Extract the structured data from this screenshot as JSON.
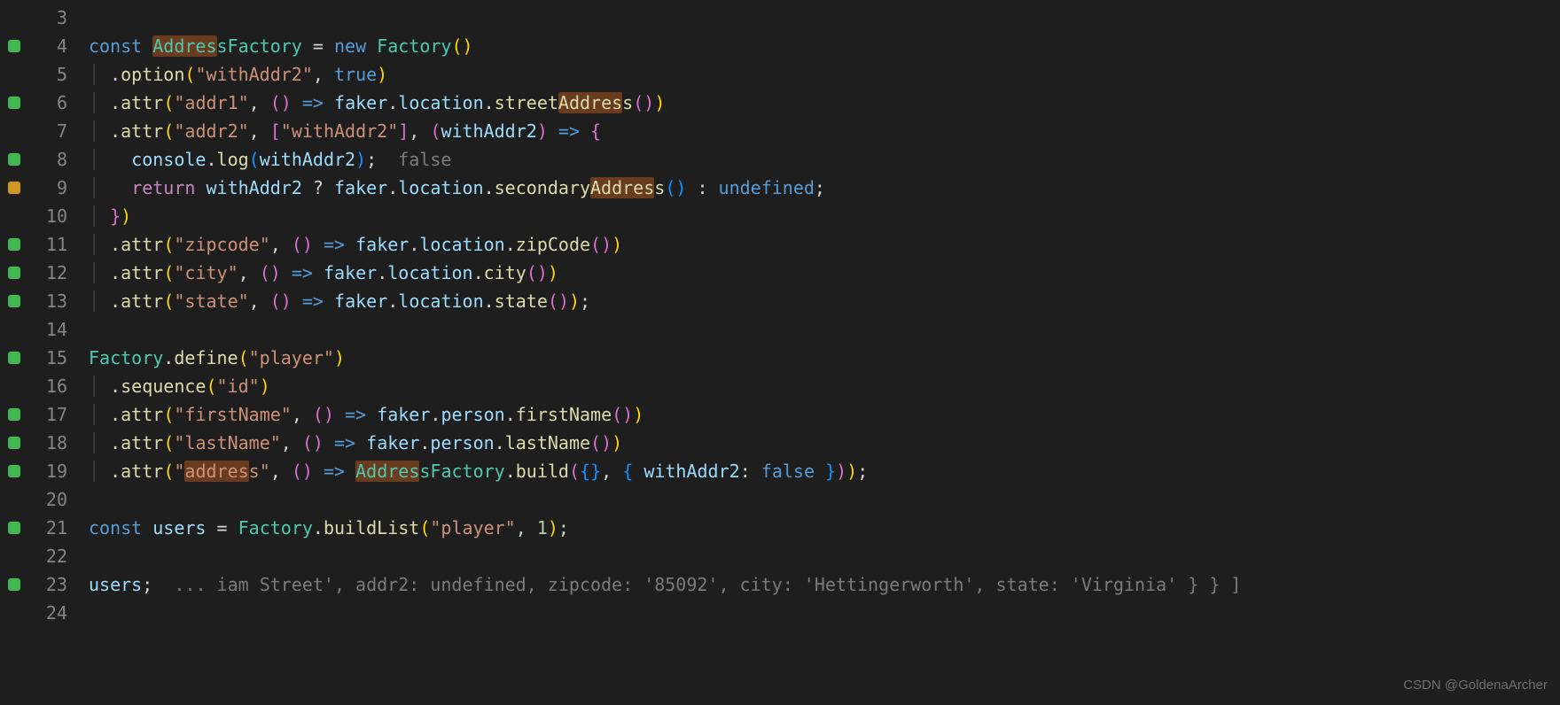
{
  "watermark": "CSDN @GoldenaArcher",
  "lines": [
    {
      "n": "3",
      "mark": null,
      "tokens": [
        {
          "t": "",
          "c": ""
        }
      ]
    },
    {
      "n": "4",
      "mark": "green",
      "tokens": [
        {
          "t": "const ",
          "c": "kw"
        },
        {
          "t": "Addres",
          "c": "cls hl"
        },
        {
          "t": "s",
          "c": "cls"
        },
        {
          "t": "Factory",
          "c": "cls"
        },
        {
          "t": " ",
          "c": ""
        },
        {
          "t": "=",
          "c": "punct"
        },
        {
          "t": " ",
          "c": ""
        },
        {
          "t": "new ",
          "c": "kw"
        },
        {
          "t": "Factory",
          "c": "cls"
        },
        {
          "t": "(",
          "c": "punct-yellow"
        },
        {
          "t": ")",
          "c": "punct-yellow"
        }
      ]
    },
    {
      "n": "5",
      "mark": null,
      "indent": "  ",
      "guide": true,
      "tokens": [
        {
          "t": ".",
          "c": "punct"
        },
        {
          "t": "option",
          "c": "fn"
        },
        {
          "t": "(",
          "c": "punct-yellow"
        },
        {
          "t": "\"withAddr2\"",
          "c": "str"
        },
        {
          "t": ", ",
          "c": "punct"
        },
        {
          "t": "true",
          "c": "bool"
        },
        {
          "t": ")",
          "c": "punct-yellow"
        }
      ]
    },
    {
      "n": "6",
      "mark": "green",
      "indent": "  ",
      "guide": true,
      "tokens": [
        {
          "t": ".",
          "c": "punct"
        },
        {
          "t": "attr",
          "c": "fn"
        },
        {
          "t": "(",
          "c": "punct-yellow"
        },
        {
          "t": "\"addr1\"",
          "c": "str"
        },
        {
          "t": ", ",
          "c": "punct"
        },
        {
          "t": "(",
          "c": "punct-pink"
        },
        {
          "t": ")",
          "c": "punct-pink"
        },
        {
          "t": " ",
          "c": ""
        },
        {
          "t": "=>",
          "c": "kw"
        },
        {
          "t": " ",
          "c": ""
        },
        {
          "t": "faker",
          "c": "var"
        },
        {
          "t": ".",
          "c": "punct"
        },
        {
          "t": "location",
          "c": "prop"
        },
        {
          "t": ".",
          "c": "punct"
        },
        {
          "t": "street",
          "c": "fn"
        },
        {
          "t": "Addres",
          "c": "fn hl"
        },
        {
          "t": "s",
          "c": "fn"
        },
        {
          "t": "(",
          "c": "punct-pink"
        },
        {
          "t": ")",
          "c": "punct-pink"
        },
        {
          "t": ")",
          "c": "punct-yellow"
        }
      ]
    },
    {
      "n": "7",
      "mark": null,
      "indent": "  ",
      "guide": true,
      "tokens": [
        {
          "t": ".",
          "c": "punct"
        },
        {
          "t": "attr",
          "c": "fn"
        },
        {
          "t": "(",
          "c": "punct-yellow"
        },
        {
          "t": "\"addr2\"",
          "c": "str"
        },
        {
          "t": ", ",
          "c": "punct"
        },
        {
          "t": "[",
          "c": "punct-pink"
        },
        {
          "t": "\"withAddr2\"",
          "c": "str"
        },
        {
          "t": "]",
          "c": "punct-pink"
        },
        {
          "t": ", ",
          "c": "punct"
        },
        {
          "t": "(",
          "c": "punct-pink"
        },
        {
          "t": "withAddr2",
          "c": "var"
        },
        {
          "t": ")",
          "c": "punct-pink"
        },
        {
          "t": " ",
          "c": ""
        },
        {
          "t": "=>",
          "c": "kw"
        },
        {
          "t": " ",
          "c": ""
        },
        {
          "t": "{",
          "c": "punct-pink"
        }
      ]
    },
    {
      "n": "8",
      "mark": "green",
      "indent": "    ",
      "guide": true,
      "tokens": [
        {
          "t": "console",
          "c": "var"
        },
        {
          "t": ".",
          "c": "punct"
        },
        {
          "t": "log",
          "c": "fn"
        },
        {
          "t": "(",
          "c": "punct-blue"
        },
        {
          "t": "withAddr2",
          "c": "var"
        },
        {
          "t": ")",
          "c": "punct-blue"
        },
        {
          "t": ";",
          "c": "punct"
        },
        {
          "t": "  ",
          "c": ""
        },
        {
          "t": "false",
          "c": "hint"
        }
      ]
    },
    {
      "n": "9",
      "mark": "yellow",
      "indent": "    ",
      "guide": true,
      "tokens": [
        {
          "t": "return ",
          "c": "kw2"
        },
        {
          "t": "withAddr2",
          "c": "var"
        },
        {
          "t": " ",
          "c": ""
        },
        {
          "t": "?",
          "c": "punct"
        },
        {
          "t": " ",
          "c": ""
        },
        {
          "t": "faker",
          "c": "var"
        },
        {
          "t": ".",
          "c": "punct"
        },
        {
          "t": "location",
          "c": "prop"
        },
        {
          "t": ".",
          "c": "punct"
        },
        {
          "t": "secondary",
          "c": "fn"
        },
        {
          "t": "Addres",
          "c": "fn hl"
        },
        {
          "t": "s",
          "c": "fn"
        },
        {
          "t": "(",
          "c": "punct-blue"
        },
        {
          "t": ")",
          "c": "punct-blue"
        },
        {
          "t": " ",
          "c": ""
        },
        {
          "t": ":",
          "c": "punct"
        },
        {
          "t": " ",
          "c": ""
        },
        {
          "t": "undefined",
          "c": "bool"
        },
        {
          "t": ";",
          "c": "punct"
        }
      ]
    },
    {
      "n": "10",
      "mark": null,
      "indent": "  ",
      "guide": true,
      "tokens": [
        {
          "t": "}",
          "c": "punct-pink"
        },
        {
          "t": ")",
          "c": "punct-yellow"
        }
      ]
    },
    {
      "n": "11",
      "mark": "green",
      "indent": "  ",
      "guide": true,
      "tokens": [
        {
          "t": ".",
          "c": "punct"
        },
        {
          "t": "attr",
          "c": "fn"
        },
        {
          "t": "(",
          "c": "punct-yellow"
        },
        {
          "t": "\"zipcode\"",
          "c": "str"
        },
        {
          "t": ", ",
          "c": "punct"
        },
        {
          "t": "(",
          "c": "punct-pink"
        },
        {
          "t": ")",
          "c": "punct-pink"
        },
        {
          "t": " ",
          "c": ""
        },
        {
          "t": "=>",
          "c": "kw"
        },
        {
          "t": " ",
          "c": ""
        },
        {
          "t": "faker",
          "c": "var"
        },
        {
          "t": ".",
          "c": "punct"
        },
        {
          "t": "location",
          "c": "prop"
        },
        {
          "t": ".",
          "c": "punct"
        },
        {
          "t": "zipCode",
          "c": "fn"
        },
        {
          "t": "(",
          "c": "punct-pink"
        },
        {
          "t": ")",
          "c": "punct-pink"
        },
        {
          "t": ")",
          "c": "punct-yellow"
        }
      ]
    },
    {
      "n": "12",
      "mark": "green",
      "indent": "  ",
      "guide": true,
      "tokens": [
        {
          "t": ".",
          "c": "punct"
        },
        {
          "t": "attr",
          "c": "fn"
        },
        {
          "t": "(",
          "c": "punct-yellow"
        },
        {
          "t": "\"city\"",
          "c": "str"
        },
        {
          "t": ", ",
          "c": "punct"
        },
        {
          "t": "(",
          "c": "punct-pink"
        },
        {
          "t": ")",
          "c": "punct-pink"
        },
        {
          "t": " ",
          "c": ""
        },
        {
          "t": "=>",
          "c": "kw"
        },
        {
          "t": " ",
          "c": ""
        },
        {
          "t": "faker",
          "c": "var"
        },
        {
          "t": ".",
          "c": "punct"
        },
        {
          "t": "location",
          "c": "prop"
        },
        {
          "t": ".",
          "c": "punct"
        },
        {
          "t": "city",
          "c": "fn"
        },
        {
          "t": "(",
          "c": "punct-pink"
        },
        {
          "t": ")",
          "c": "punct-pink"
        },
        {
          "t": ")",
          "c": "punct-yellow"
        }
      ]
    },
    {
      "n": "13",
      "mark": "green",
      "indent": "  ",
      "guide": true,
      "tokens": [
        {
          "t": ".",
          "c": "punct"
        },
        {
          "t": "attr",
          "c": "fn"
        },
        {
          "t": "(",
          "c": "punct-yellow"
        },
        {
          "t": "\"state\"",
          "c": "str"
        },
        {
          "t": ", ",
          "c": "punct"
        },
        {
          "t": "(",
          "c": "punct-pink"
        },
        {
          "t": ")",
          "c": "punct-pink"
        },
        {
          "t": " ",
          "c": ""
        },
        {
          "t": "=>",
          "c": "kw"
        },
        {
          "t": " ",
          "c": ""
        },
        {
          "t": "faker",
          "c": "var"
        },
        {
          "t": ".",
          "c": "punct"
        },
        {
          "t": "location",
          "c": "prop"
        },
        {
          "t": ".",
          "c": "punct"
        },
        {
          "t": "state",
          "c": "fn"
        },
        {
          "t": "(",
          "c": "punct-pink"
        },
        {
          "t": ")",
          "c": "punct-pink"
        },
        {
          "t": ")",
          "c": "punct-yellow"
        },
        {
          "t": ";",
          "c": "punct"
        }
      ]
    },
    {
      "n": "14",
      "mark": null,
      "tokens": [
        {
          "t": "",
          "c": ""
        }
      ]
    },
    {
      "n": "15",
      "mark": "green",
      "tokens": [
        {
          "t": "Factory",
          "c": "cls"
        },
        {
          "t": ".",
          "c": "punct"
        },
        {
          "t": "define",
          "c": "fn"
        },
        {
          "t": "(",
          "c": "punct-yellow"
        },
        {
          "t": "\"player\"",
          "c": "str"
        },
        {
          "t": ")",
          "c": "punct-yellow"
        }
      ]
    },
    {
      "n": "16",
      "mark": null,
      "indent": "  ",
      "guide": true,
      "tokens": [
        {
          "t": ".",
          "c": "punct"
        },
        {
          "t": "sequence",
          "c": "fn"
        },
        {
          "t": "(",
          "c": "punct-yellow"
        },
        {
          "t": "\"id\"",
          "c": "str"
        },
        {
          "t": ")",
          "c": "punct-yellow"
        }
      ]
    },
    {
      "n": "17",
      "mark": "green",
      "indent": "  ",
      "guide": true,
      "tokens": [
        {
          "t": ".",
          "c": "punct"
        },
        {
          "t": "attr",
          "c": "fn"
        },
        {
          "t": "(",
          "c": "punct-yellow"
        },
        {
          "t": "\"firstName\"",
          "c": "str"
        },
        {
          "t": ", ",
          "c": "punct"
        },
        {
          "t": "(",
          "c": "punct-pink"
        },
        {
          "t": ")",
          "c": "punct-pink"
        },
        {
          "t": " ",
          "c": ""
        },
        {
          "t": "=>",
          "c": "kw"
        },
        {
          "t": " ",
          "c": ""
        },
        {
          "t": "faker",
          "c": "var"
        },
        {
          "t": ".",
          "c": "punct"
        },
        {
          "t": "person",
          "c": "prop"
        },
        {
          "t": ".",
          "c": "punct"
        },
        {
          "t": "firstName",
          "c": "fn"
        },
        {
          "t": "(",
          "c": "punct-pink"
        },
        {
          "t": ")",
          "c": "punct-pink"
        },
        {
          "t": ")",
          "c": "punct-yellow"
        }
      ]
    },
    {
      "n": "18",
      "mark": "green",
      "indent": "  ",
      "guide": true,
      "tokens": [
        {
          "t": ".",
          "c": "punct"
        },
        {
          "t": "attr",
          "c": "fn"
        },
        {
          "t": "(",
          "c": "punct-yellow"
        },
        {
          "t": "\"lastName\"",
          "c": "str"
        },
        {
          "t": ", ",
          "c": "punct"
        },
        {
          "t": "(",
          "c": "punct-pink"
        },
        {
          "t": ")",
          "c": "punct-pink"
        },
        {
          "t": " ",
          "c": ""
        },
        {
          "t": "=>",
          "c": "kw"
        },
        {
          "t": " ",
          "c": ""
        },
        {
          "t": "faker",
          "c": "var"
        },
        {
          "t": ".",
          "c": "punct"
        },
        {
          "t": "person",
          "c": "prop"
        },
        {
          "t": ".",
          "c": "punct"
        },
        {
          "t": "lastName",
          "c": "fn"
        },
        {
          "t": "(",
          "c": "punct-pink"
        },
        {
          "t": ")",
          "c": "punct-pink"
        },
        {
          "t": ")",
          "c": "punct-yellow"
        }
      ]
    },
    {
      "n": "19",
      "mark": "green",
      "indent": "  ",
      "guide": true,
      "tokens": [
        {
          "t": ".",
          "c": "punct"
        },
        {
          "t": "attr",
          "c": "fn"
        },
        {
          "t": "(",
          "c": "punct-yellow"
        },
        {
          "t": "\"",
          "c": "str"
        },
        {
          "t": "addres",
          "c": "str hl"
        },
        {
          "t": "s\"",
          "c": "str"
        },
        {
          "t": ", ",
          "c": "punct"
        },
        {
          "t": "(",
          "c": "punct-pink"
        },
        {
          "t": ")",
          "c": "punct-pink"
        },
        {
          "t": " ",
          "c": ""
        },
        {
          "t": "=>",
          "c": "kw"
        },
        {
          "t": " ",
          "c": ""
        },
        {
          "t": "Addres",
          "c": "cls hl"
        },
        {
          "t": "s",
          "c": "cls"
        },
        {
          "t": "Factory",
          "c": "cls"
        },
        {
          "t": ".",
          "c": "punct"
        },
        {
          "t": "build",
          "c": "fn"
        },
        {
          "t": "(",
          "c": "punct-pink"
        },
        {
          "t": "{",
          "c": "punct-blue"
        },
        {
          "t": "}",
          "c": "punct-blue"
        },
        {
          "t": ", ",
          "c": "punct"
        },
        {
          "t": "{",
          "c": "punct-blue"
        },
        {
          "t": " ",
          "c": ""
        },
        {
          "t": "withAddr2",
          "c": "prop"
        },
        {
          "t": ":",
          "c": "punct"
        },
        {
          "t": " ",
          "c": ""
        },
        {
          "t": "false",
          "c": "bool"
        },
        {
          "t": " ",
          "c": ""
        },
        {
          "t": "}",
          "c": "punct-blue"
        },
        {
          "t": ")",
          "c": "punct-pink"
        },
        {
          "t": ")",
          "c": "punct-yellow"
        },
        {
          "t": ";",
          "c": "punct"
        }
      ]
    },
    {
      "n": "20",
      "mark": null,
      "tokens": [
        {
          "t": "",
          "c": ""
        }
      ]
    },
    {
      "n": "21",
      "mark": "green",
      "tokens": [
        {
          "t": "const ",
          "c": "kw"
        },
        {
          "t": "users",
          "c": "var"
        },
        {
          "t": " ",
          "c": ""
        },
        {
          "t": "=",
          "c": "punct"
        },
        {
          "t": " ",
          "c": ""
        },
        {
          "t": "Factory",
          "c": "cls"
        },
        {
          "t": ".",
          "c": "punct"
        },
        {
          "t": "buildList",
          "c": "fn"
        },
        {
          "t": "(",
          "c": "punct-yellow"
        },
        {
          "t": "\"player\"",
          "c": "str"
        },
        {
          "t": ", ",
          "c": "punct"
        },
        {
          "t": "1",
          "c": "num"
        },
        {
          "t": ")",
          "c": "punct-yellow"
        },
        {
          "t": ";",
          "c": "punct"
        }
      ]
    },
    {
      "n": "22",
      "mark": null,
      "tokens": [
        {
          "t": "",
          "c": ""
        }
      ]
    },
    {
      "n": "23",
      "mark": "green",
      "tokens": [
        {
          "t": "users",
          "c": "var"
        },
        {
          "t": ";",
          "c": "punct"
        },
        {
          "t": "  ",
          "c": ""
        },
        {
          "t": "... iam Street', addr2: undefined, zipcode: '85092', city: 'Hettingerworth', state: 'Virginia' } } ]",
          "c": "hint"
        }
      ]
    },
    {
      "n": "24",
      "mark": null,
      "tokens": [
        {
          "t": "",
          "c": ""
        }
      ]
    }
  ]
}
